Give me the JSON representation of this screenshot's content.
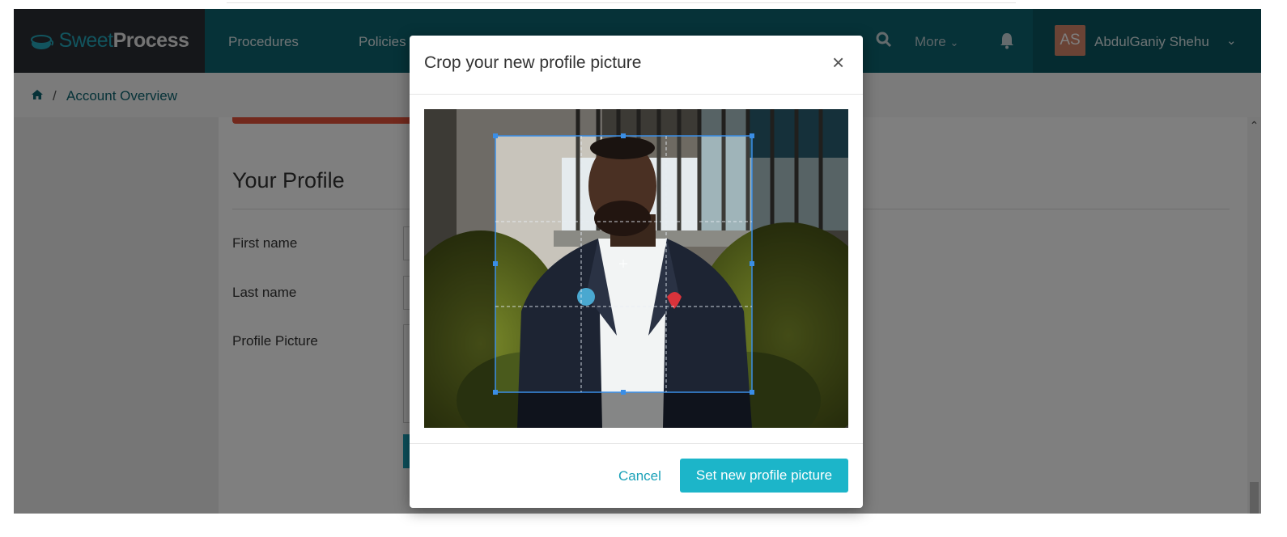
{
  "brand": {
    "light": "Sweet",
    "bold": "Process"
  },
  "nav": {
    "items": [
      {
        "label": "Procedures"
      },
      {
        "label": "Policies"
      }
    ],
    "more_label": "More",
    "user": {
      "initials": "AS",
      "name": "AbdulGaniy Shehu"
    }
  },
  "breadcrumb": {
    "home_icon": "home-icon",
    "separator": "/",
    "current": "Account Overview"
  },
  "profile": {
    "title": "Your Profile",
    "fields": [
      {
        "label": "First name"
      },
      {
        "label": "Last name"
      },
      {
        "label": "Profile Picture"
      }
    ]
  },
  "modal": {
    "title": "Crop your new profile picture",
    "close": "×",
    "cancel_label": "Cancel",
    "confirm_label": "Set new profile picture"
  },
  "colors": {
    "topbar": "#0c6471",
    "brand_dark": "#2a2f35",
    "accent": "#1cb5c9",
    "crop_border": "#3a8ee6",
    "alert": "#e4523b"
  }
}
